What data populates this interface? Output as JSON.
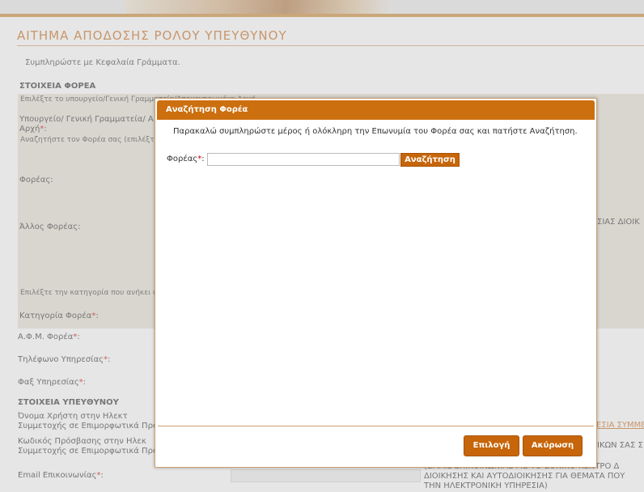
{
  "header": {
    "title": "ΑΙΤΗΜΑ ΑΠΟΔΟΣΗΣ ΡΟΛΟΥ ΥΠΕΥΘΥΝΟΥ",
    "note": "Συμπληρώστε με Κεφαλαία Γράμματα."
  },
  "agency_section": {
    "heading": "ΣΤΟΙΧΕΙΑ ΦΟΡΕΑ",
    "choose_ministry": "Επιλέξτε το υπουργείο/Γενική Γραμματεία/Αποκεντρωμένη Αρχή",
    "ministry_label_1": "Υπουργείο/  Γενική  Γραμματεία/  Α",
    "ministry_label_2": "Αρχή",
    "search_agency_hint": "Αναζητήστε τον Φορέα σας (επιλέξτε",
    "agency_label": "Φορέας:",
    "other_agency_label": "Άλλος Φορέας:",
    "right_fragment": "ΣΙΑΣ ΔΙΟΙΚ",
    "choose_category": "Επιλέξτε την κατηγορία που ανήκει ο φ",
    "category_label": "Κατηγορία Φορέα",
    "afm_label": "Α.Φ.Μ. Φορέα",
    "phone_label": "Τηλέφωνο Υπηρεσίας",
    "fax_label": "Φαξ Υπηρεσίας"
  },
  "manager_section": {
    "heading": "ΣΤΟΙΧΕΙΑ ΥΠΕΥΘΥΝΟΥ",
    "username_line1": "Όνομα  Χρήστη  στην  Ηλεκτ",
    "username_line2": "Συμμετοχής σε Επιμορφωτικά Προγ",
    "password_line1": "Κωδικός  Πρόσβασης  στην  Ηλεκ",
    "password_line2": "Συμμετοχής σε Επιμορφωτικά Προγ",
    "link_fragment": "ΕΣΙΑ ΣΥΜΜΕ",
    "right_fragment2": "ΙΚΩΝ ΣΑΣ Σ",
    "email_label": "Email Επικοινωνίας",
    "email_note_1": "(EMAIL  ΕΠΙΚΟΙΝΩΝΙΑΣ  ΜΕ  ΤΟ  ΕΘΝΙΚΟ  ΚΕΝΤΡΟ  Δ",
    "email_note_2": "ΔΙΟΙΚΗΣΗΣ ΚΑΙ ΑΥΤΟΔΙΟΙΚΗΣΗΣ ΓΙΑ ΘΕΜΑΤΑ ΠΟΥ",
    "email_note_3": "ΤΗΝ ΗΛΕΚΤΡΟΝΙΚΗ ΥΠΗΡΕΣΙΑ)"
  },
  "required_mark": "*",
  "colon": ":",
  "modal": {
    "title": "Αναζήτηση Φορέα",
    "instruction": "Παρακαλώ συμπληρώστε μέρος ή ολόκληρη την Επωνυμία του Φορέα σας και πατήστε Αναζήτηση.",
    "field_label": "Φορέας",
    "field_value": "",
    "search_button": "Αναζήτηση",
    "select_button": "Επιλογή",
    "cancel_button": "Ακύρωση"
  },
  "colors": {
    "accent": "#cc6f0f",
    "title": "#c96d1e",
    "section_bg": "#e7e2d6"
  }
}
